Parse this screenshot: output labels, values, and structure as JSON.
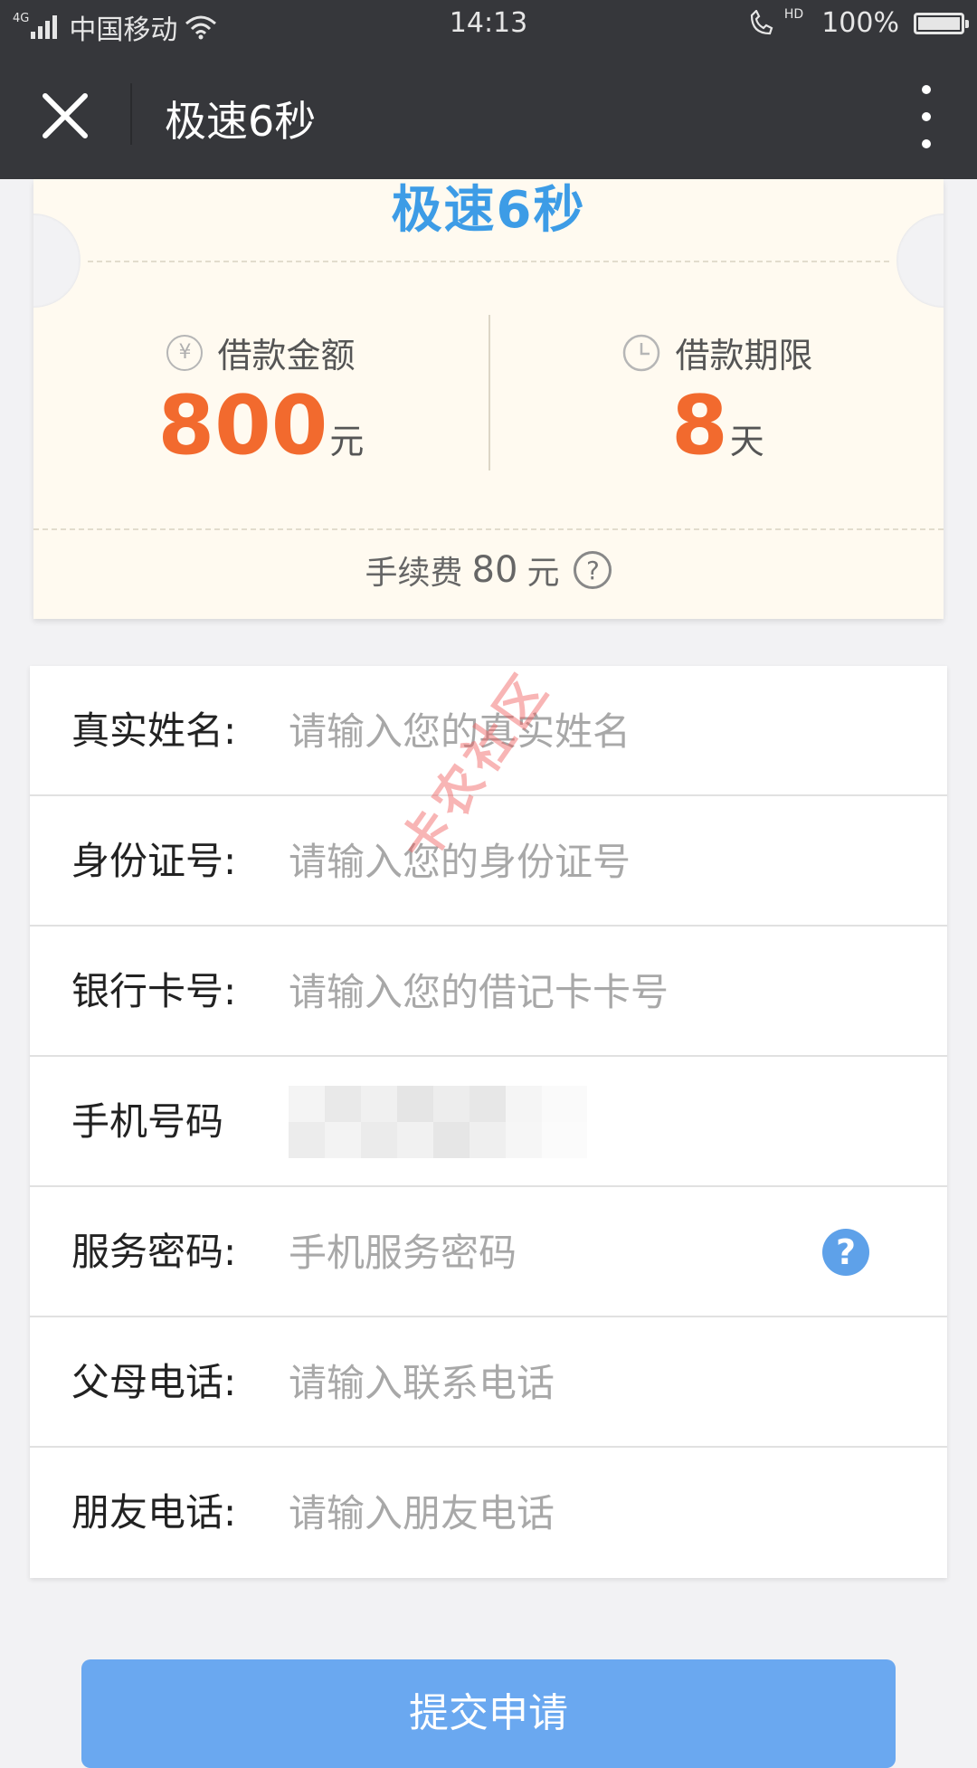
{
  "status_bar": {
    "network": "4G",
    "carrier": "中国移动",
    "time": "14:13",
    "hd": "HD",
    "battery": "100%",
    "battery_level": 1.0
  },
  "nav": {
    "title": "极速6秒"
  },
  "ticket": {
    "title": "极速6秒",
    "amount_label": "借款金额",
    "amount_value": "800",
    "amount_unit": "元",
    "term_label": "借款期限",
    "term_value": "8",
    "term_unit": "天",
    "fee_label": "手续费",
    "fee_value": "80",
    "fee_unit": "元",
    "yen_symbol": "¥"
  },
  "form": {
    "rows": [
      {
        "label": "真实姓名:",
        "placeholder": "请输入您的真实姓名"
      },
      {
        "label": "身份证号:",
        "placeholder": "请输入您的身份证号"
      },
      {
        "label": "银行卡号:",
        "placeholder": "请输入您的借记卡卡号"
      },
      {
        "label": "手机号码",
        "placeholder": ""
      },
      {
        "label": "服务密码:",
        "placeholder": "手机服务密码"
      },
      {
        "label": "父母电话:",
        "placeholder": "请输入联系电话"
      },
      {
        "label": "朋友电话:",
        "placeholder": "请输入朋友电话"
      }
    ]
  },
  "watermark": "卡农社区",
  "submit_label": "提交申请",
  "colors": {
    "accent": "#6aa8f0",
    "amount": "#f26a2e",
    "ticket_title": "#3d9ce6",
    "nav_bg": "#36373b"
  }
}
